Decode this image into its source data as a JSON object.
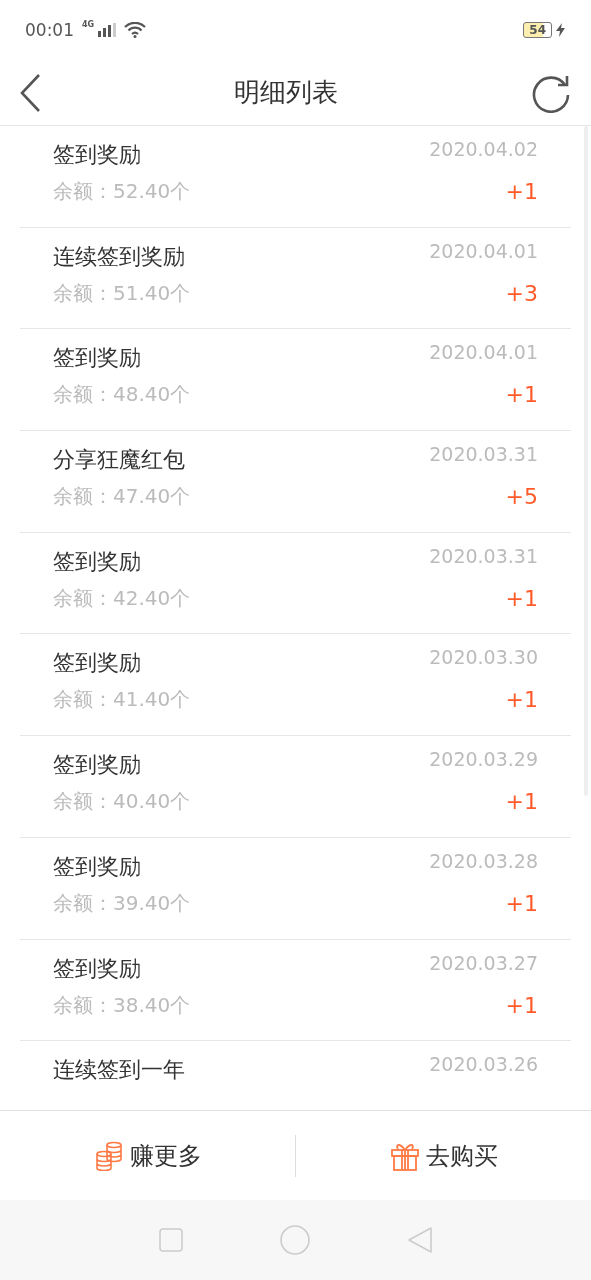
{
  "status_bar": {
    "time": "00:01",
    "network": "4G",
    "battery": "54"
  },
  "header": {
    "title": "明细列表"
  },
  "records": [
    {
      "title": "签到奖励",
      "date": "2020.04.02",
      "balance": "余额：52.40个",
      "amount": "+1"
    },
    {
      "title": "连续签到奖励",
      "date": "2020.04.01",
      "balance": "余额：51.40个",
      "amount": "+3"
    },
    {
      "title": "签到奖励",
      "date": "2020.04.01",
      "balance": "余额：48.40个",
      "amount": "+1"
    },
    {
      "title": "分享狂魔红包",
      "date": "2020.03.31",
      "balance": "余额：47.40个",
      "amount": "+5"
    },
    {
      "title": "签到奖励",
      "date": "2020.03.31",
      "balance": "余额：42.40个",
      "amount": "+1"
    },
    {
      "title": "签到奖励",
      "date": "2020.03.30",
      "balance": "余额：41.40个",
      "amount": "+1"
    },
    {
      "title": "签到奖励",
      "date": "2020.03.29",
      "balance": "余额：40.40个",
      "amount": "+1"
    },
    {
      "title": "签到奖励",
      "date": "2020.03.28",
      "balance": "余额：39.40个",
      "amount": "+1"
    },
    {
      "title": "签到奖励",
      "date": "2020.03.27",
      "balance": "余额：38.40个",
      "amount": "+1"
    },
    {
      "title": "连续签到一年",
      "date": "2020.03.26"
    }
  ],
  "bottom_bar": [
    {
      "kind": "coins",
      "label": "赚更多"
    },
    {
      "kind": "gift",
      "label": "去购买"
    }
  ]
}
